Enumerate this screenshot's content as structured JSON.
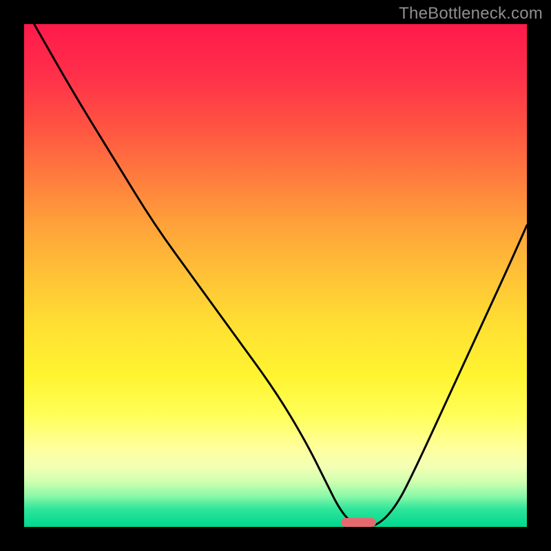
{
  "watermark": "TheBottleneck.com",
  "chart_data": {
    "type": "line",
    "title": "",
    "xlabel": "",
    "ylabel": "",
    "xlim": [
      0,
      100
    ],
    "ylim": [
      0,
      100
    ],
    "grid": false,
    "legend": false,
    "background_gradient": {
      "direction": "vertical",
      "stops": [
        {
          "pos": 0,
          "color": "#ff1a4b"
        },
        {
          "pos": 50,
          "color": "#ffc236"
        },
        {
          "pos": 78,
          "color": "#ffff5a"
        },
        {
          "pos": 100,
          "color": "#00d88f"
        }
      ]
    },
    "series": [
      {
        "name": "bottleneck-curve",
        "color": "#000000",
        "x": [
          2,
          10,
          18,
          26,
          34,
          42,
          50,
          56,
          60,
          63,
          66,
          70,
          74,
          78,
          84,
          90,
          96,
          100
        ],
        "values": [
          100,
          86,
          73,
          60,
          49,
          38,
          27,
          17,
          9,
          3,
          0,
          0,
          4,
          12,
          25,
          38,
          51,
          60
        ]
      }
    ],
    "marker": {
      "name": "optimal-range",
      "color": "#e46a6f",
      "x_start": 63,
      "x_end": 70,
      "y": 0,
      "height_pct": 1.8
    }
  }
}
